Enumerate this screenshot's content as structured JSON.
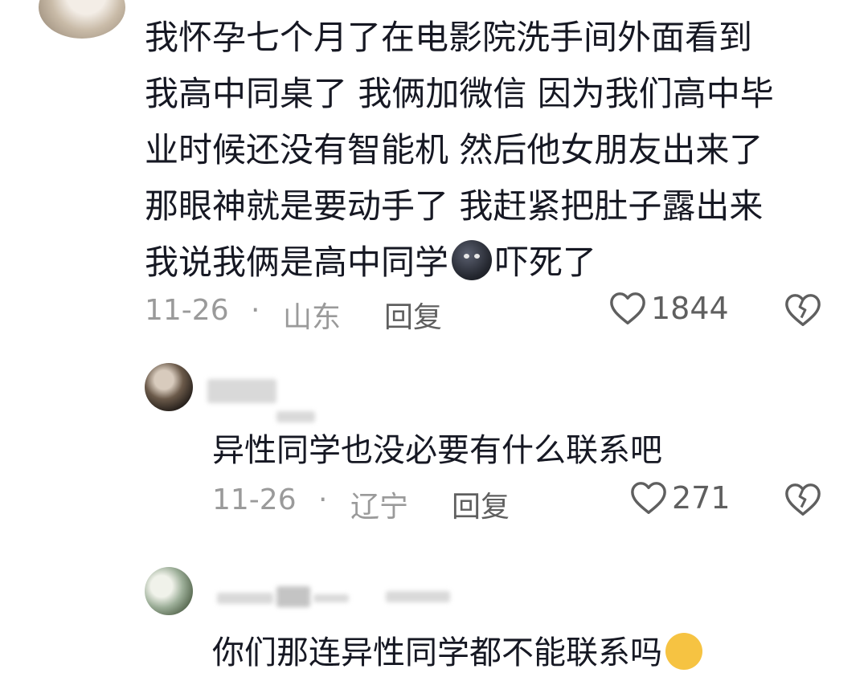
{
  "comment": {
    "text_lines": [
      "我怀孕七个月了在电影院洗手间外面看到",
      "我高中同桌了 我俩加微信 因为我们高中毕",
      "业时候还没有智能机 然后他女朋友出来了",
      "那眼神就是要动手了 我赶紧把肚子露出来",
      "我说我俩是高中同学"
    ],
    "text_after_emoji": "吓死了",
    "date": "11-26",
    "separator": "·",
    "location": "山东",
    "reply_label": "回复",
    "likes": "1844"
  },
  "replies": [
    {
      "text": "异性同学也没必要有什么联系吧",
      "date": "11-26",
      "separator": "·",
      "location": "辽宁",
      "reply_label": "回复",
      "likes": "271"
    },
    {
      "text": "你们那连异性同学都不能联系吗"
    }
  ],
  "colors": {
    "text": "#161823",
    "meta": "#9a9a9a",
    "action": "#5f5f5f"
  }
}
